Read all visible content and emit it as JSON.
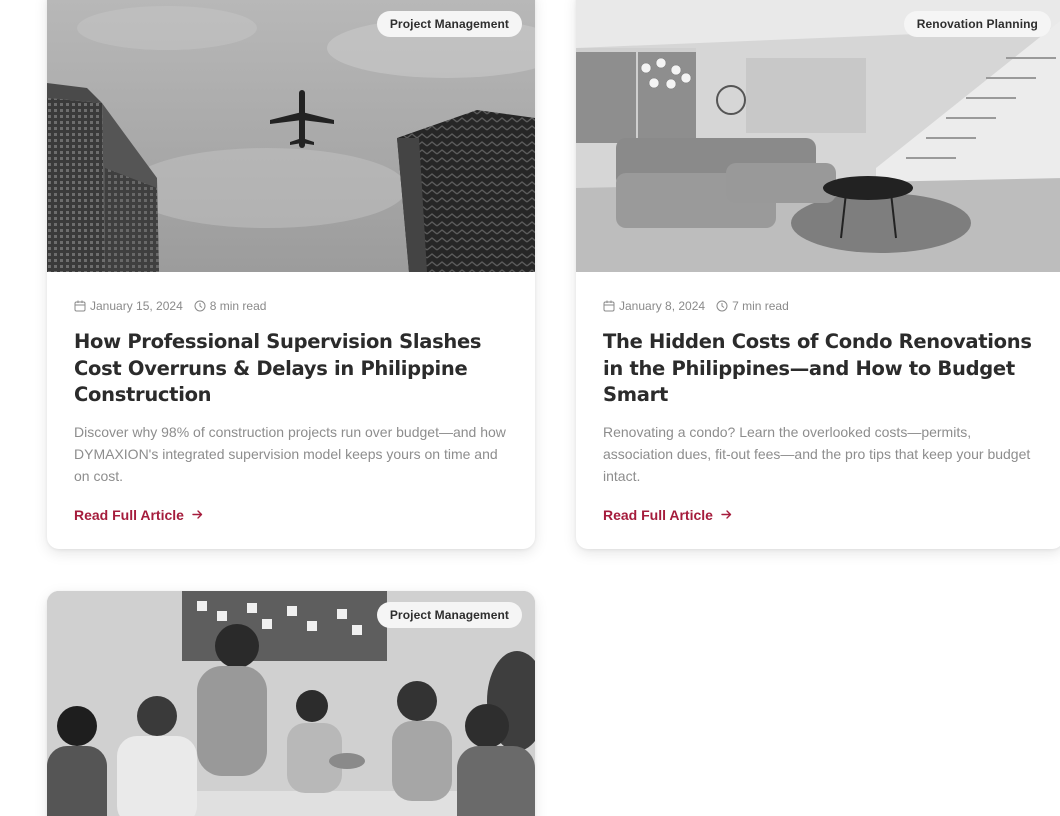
{
  "posts": [
    {
      "category": "Project Management",
      "date": "January 15, 2024",
      "read_time": "8 min read",
      "title": "How Professional Supervision Slashes Cost Overruns & Delays in Philippine Construction",
      "excerpt": "Discover why 98% of construction projects run over budget—and how DYMAXION's integrated supervision model keeps yours on time and on cost.",
      "cta": "Read Full Article",
      "image": "airplane-between-skyscrapers"
    },
    {
      "category": "Renovation Planning",
      "date": "January 8, 2024",
      "read_time": "7 min read",
      "title": "The Hidden Costs of Condo Renovations in the Philippines—and How to Budget Smart",
      "excerpt": "Renovating a condo? Learn the overlooked costs—permits, association dues, fit-out fees—and the pro tips that keep your budget intact.",
      "cta": "Read Full Article",
      "image": "modern-condo-living-room"
    },
    {
      "category": "Project Management",
      "image": "team-meeting-handshake"
    }
  ],
  "icons": {
    "date": "calendar-icon",
    "read_time": "clock-icon",
    "cta": "arrow-right-icon"
  },
  "colors": {
    "accent": "#a51c3c",
    "title": "#2b2b2b",
    "muted": "#8d8d8d"
  }
}
